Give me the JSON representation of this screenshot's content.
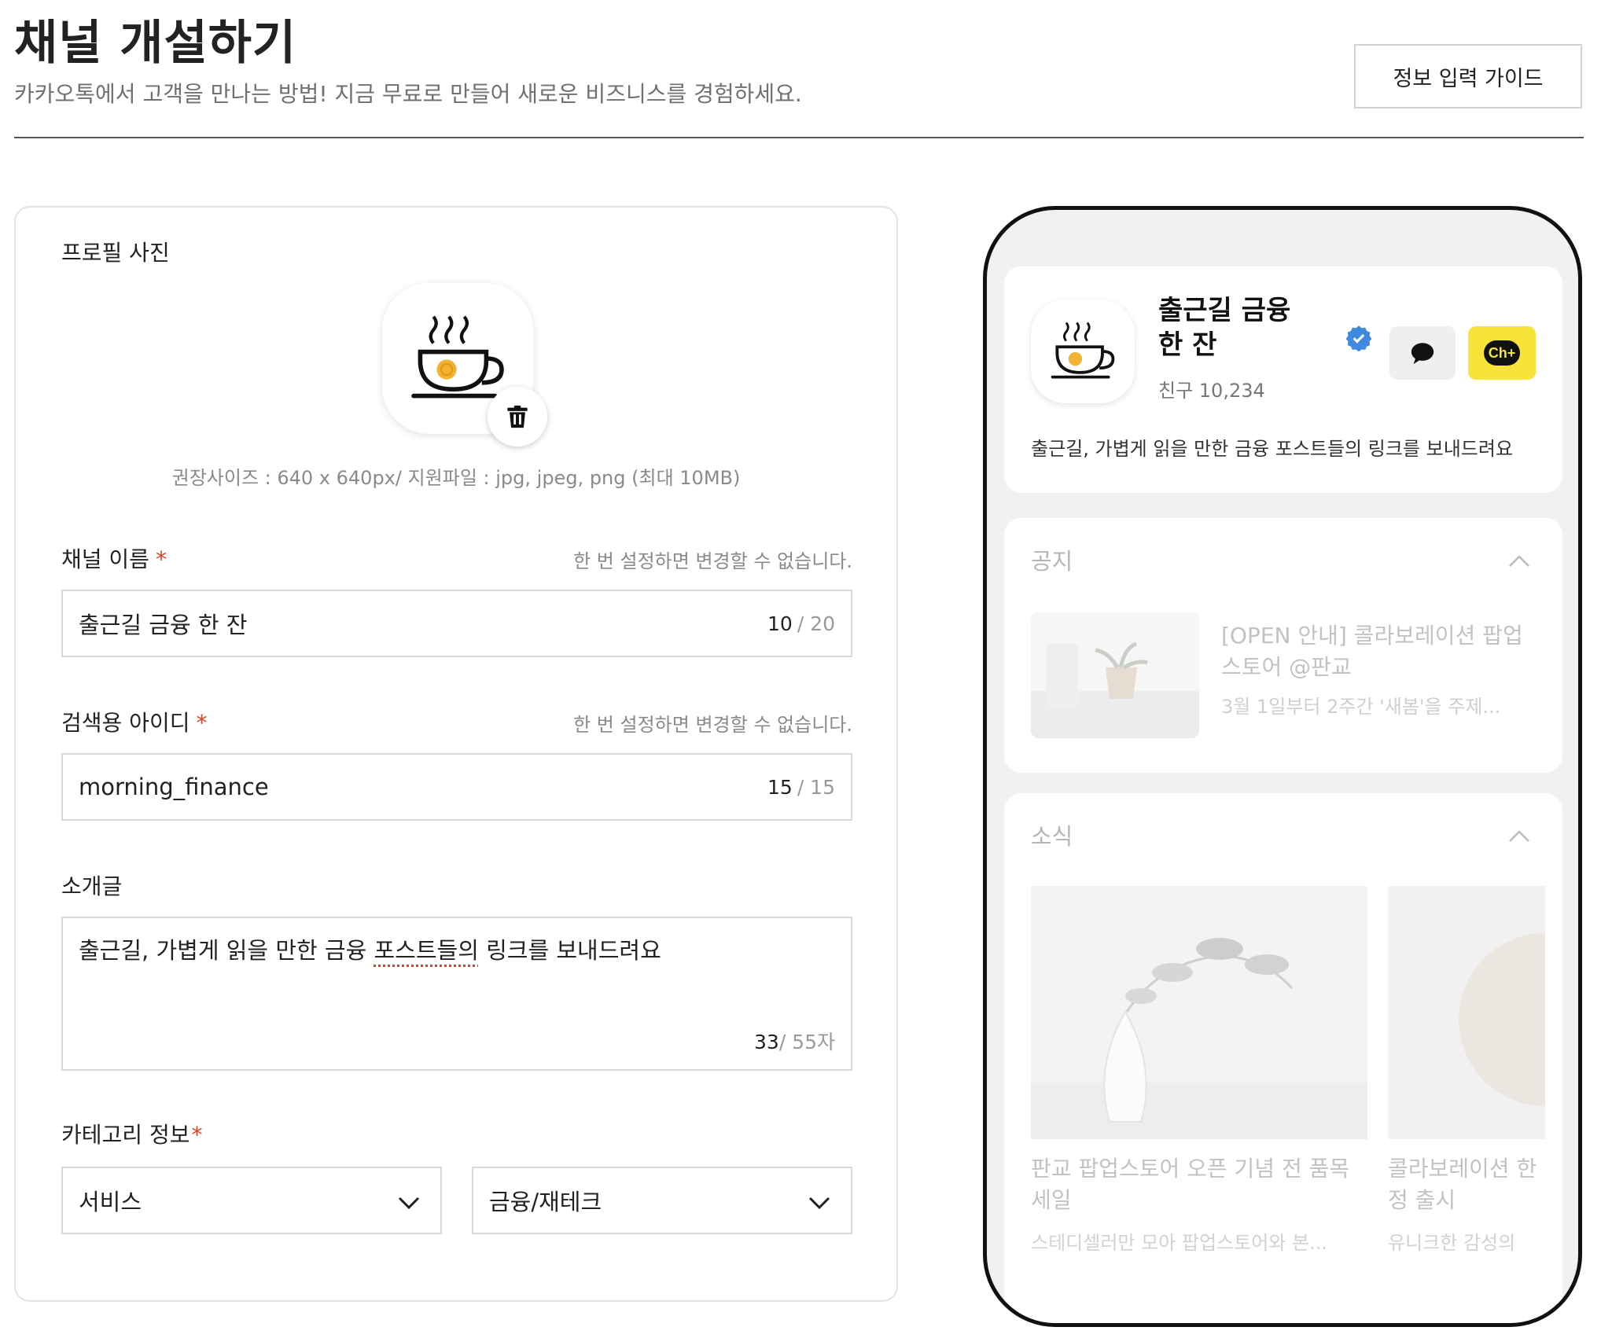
{
  "header": {
    "title": "채널 개설하기",
    "subtitle": "카카오톡에서 고객을 만나는 방법! 지금 무료로 만들어 새로운 비즈니스를 경험하세요.",
    "guide_button": "정보 입력 가이드"
  },
  "form": {
    "profile_photo": {
      "label": "프로필 사진",
      "hint": "권장사이즈 : 640 x 640px/ 지원파일 : jpg, jpeg, png (최대 10MB)"
    },
    "channel_name": {
      "label": "채널 이름",
      "required_mark": "*",
      "hint": "한 번 설정하면 변경할 수 없습니다.",
      "value": "출근길 금융 한 잔",
      "count": "10",
      "max": "/ 20"
    },
    "search_id": {
      "label": "검색용 아이디",
      "required_mark": "*",
      "hint": "한 번 설정하면 변경할 수 없습니다.",
      "value": "morning_finance",
      "count": "15",
      "max": "/ 15"
    },
    "intro": {
      "label": "소개글",
      "value_before": "출근길, 가볍게 읽을 만한 금융 ",
      "value_misspelled": "포스트들의",
      "value_after": " 링크를 보내드려요",
      "count": "33",
      "max": "/ 55자"
    },
    "category": {
      "label": "카테고리 정보",
      "required_mark": "*",
      "primary": "서비스",
      "secondary": "금융/재테크"
    }
  },
  "preview": {
    "profile": {
      "name": "출근길 금융 한 잔",
      "friends": "친구 10,234",
      "intro": "출근길, 가볍게 읽을 만한 금융 포스트들의 링크를 보내드려요",
      "add_button_text": "Ch+"
    },
    "notice": {
      "title": "공지",
      "item_title": "[OPEN 안내] 콜라보레이션 팝업 스토어 @판교",
      "item_desc": "3월 1일부터 2주간 '새봄'을 주제..."
    },
    "news": {
      "title": "소식",
      "items": [
        {
          "title": "판교 팝업스토어 오픈 기념 전 품목 세일",
          "desc": "스테디셀러만 모아 팝업스토어와 본..."
        },
        {
          "title": "콜라보레이션 한정 출시",
          "desc": "유니크한 감성의"
        }
      ]
    }
  },
  "colors": {
    "required": "#e0401f",
    "kakao_yellow": "#f7e43a",
    "verified_blue": "#3f8ae0",
    "coin": "#f2b233"
  }
}
